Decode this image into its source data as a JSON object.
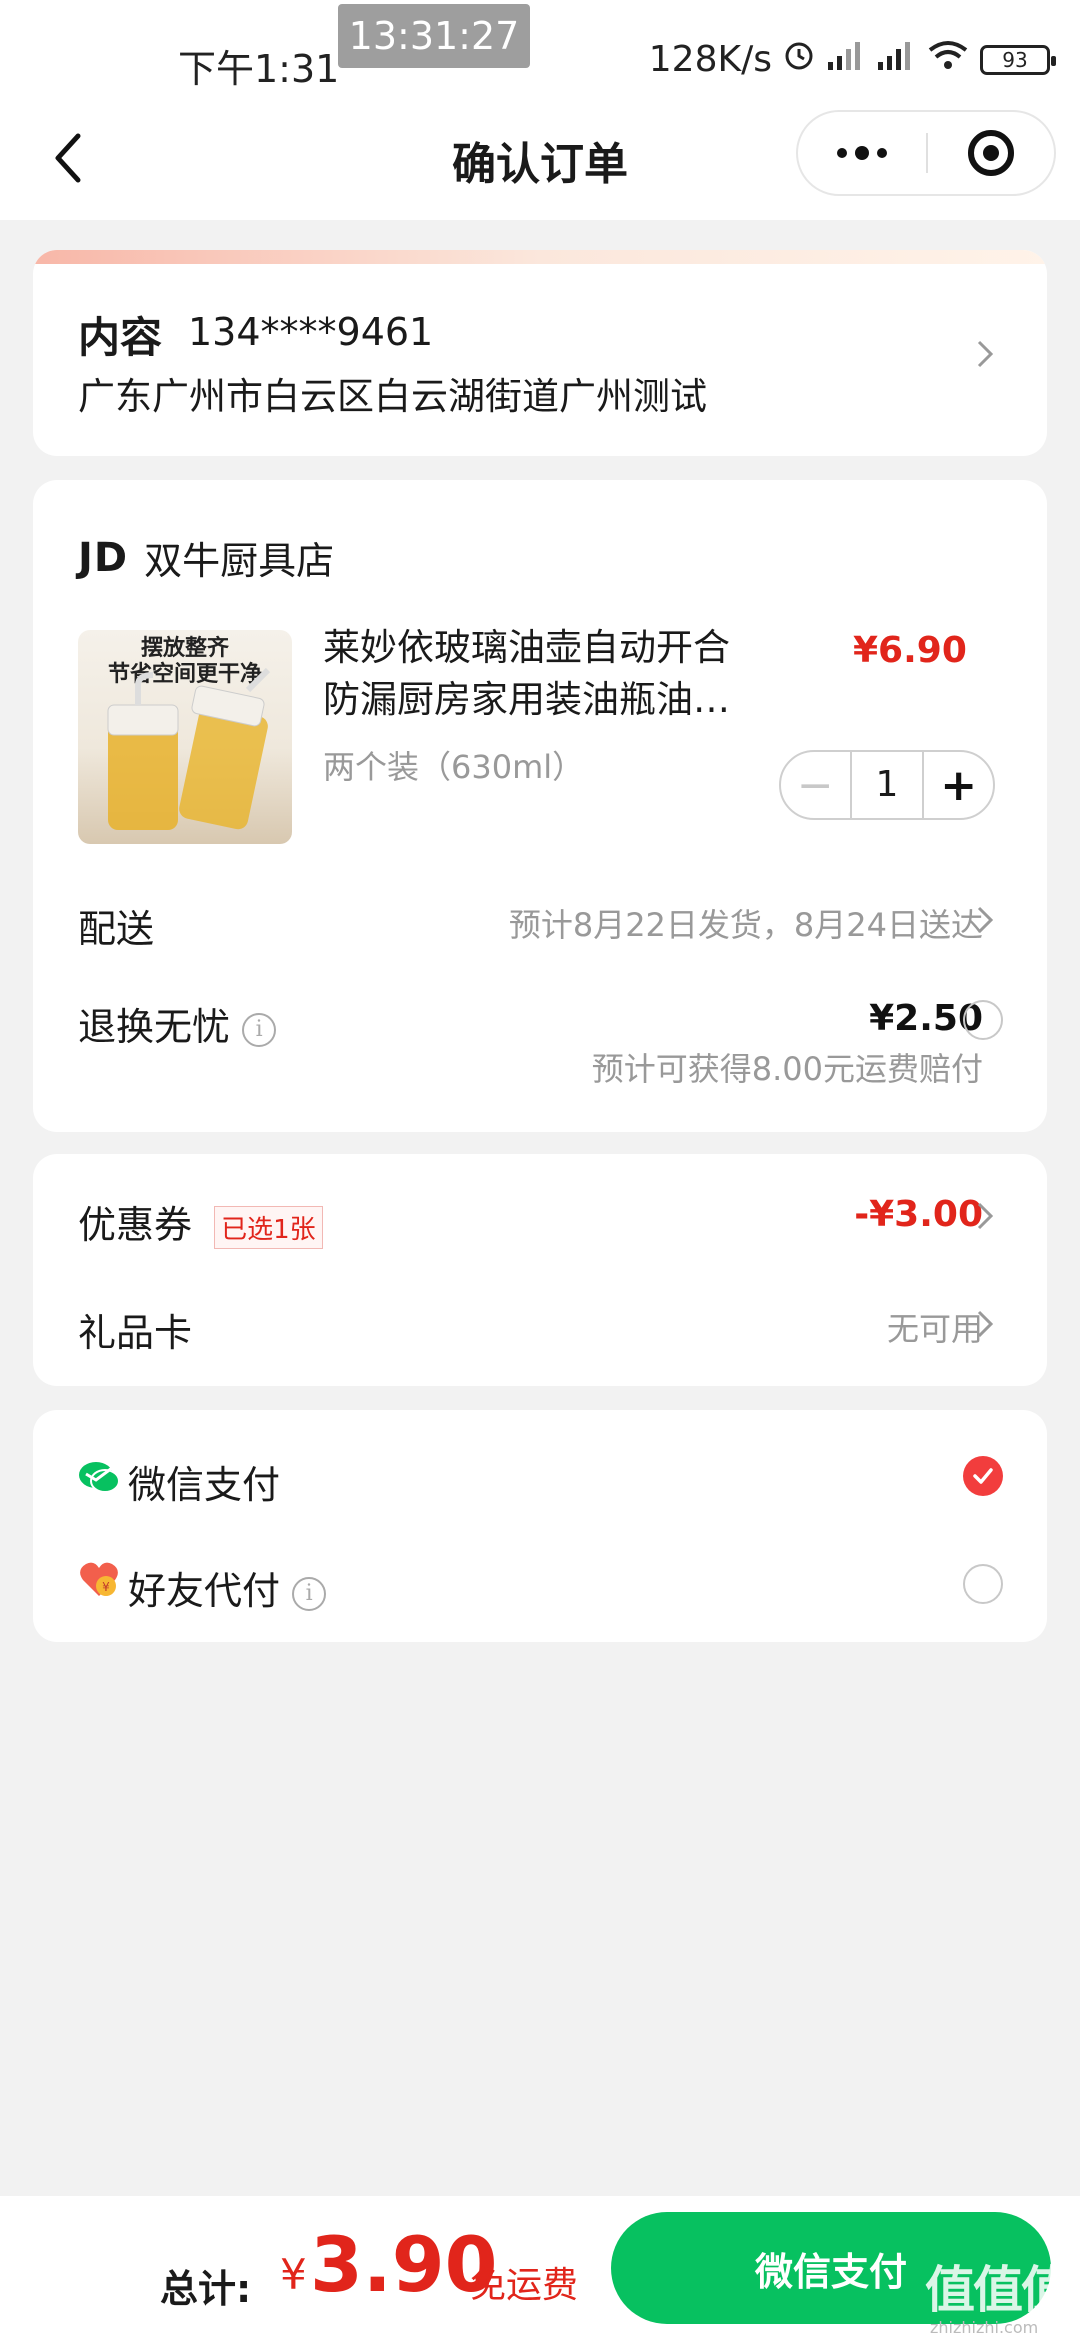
{
  "status_bar": {
    "time": "下午1:31",
    "clock_overlay": "13:31:27",
    "network_speed": "128K/s",
    "battery": "93"
  },
  "nav": {
    "title": "确认订单"
  },
  "address": {
    "name": "内容",
    "phone": "134****9461",
    "detail": "广东广州市白云区白云湖街道广州测试"
  },
  "shop": {
    "logo": "JD",
    "name": "双牛厨具店",
    "product": {
      "image_text": "摆放整齐\n节省空间更干净",
      "title": "莱妙依玻璃油壶自动开合防漏厨房家用装油瓶油…",
      "price": "¥6.90",
      "spec": "两个装（630ml）",
      "quantity": "1",
      "minus": "−",
      "plus": "+"
    },
    "delivery": {
      "label": "配送",
      "value": "预计8月22日发货，8月24日送达"
    },
    "return_service": {
      "label": "退换无忧",
      "info_icon": "i",
      "price": "¥2.50",
      "note": "预计可获得8.00元运费赔付"
    }
  },
  "coupons": {
    "label": "优惠券",
    "tag": "已选1张",
    "value": "-¥3.00"
  },
  "gift_card": {
    "label": "礼品卡",
    "value": "无可用"
  },
  "payment": {
    "wechat": {
      "label": "微信支付",
      "selected": true
    },
    "friend": {
      "label": "好友代付",
      "info_icon": "i",
      "selected": false
    }
  },
  "bottom": {
    "total_label": "总计:",
    "currency": "¥",
    "total_amount": "3.90",
    "free_shipping": "免运费",
    "pay_button": "微信支付"
  },
  "watermark": {
    "text": "值值值",
    "sub": "zhizhizhi.com"
  },
  "colors": {
    "accent_red": "#e1251b",
    "wechat_green": "#07c160",
    "background": "#f2f2f2"
  }
}
